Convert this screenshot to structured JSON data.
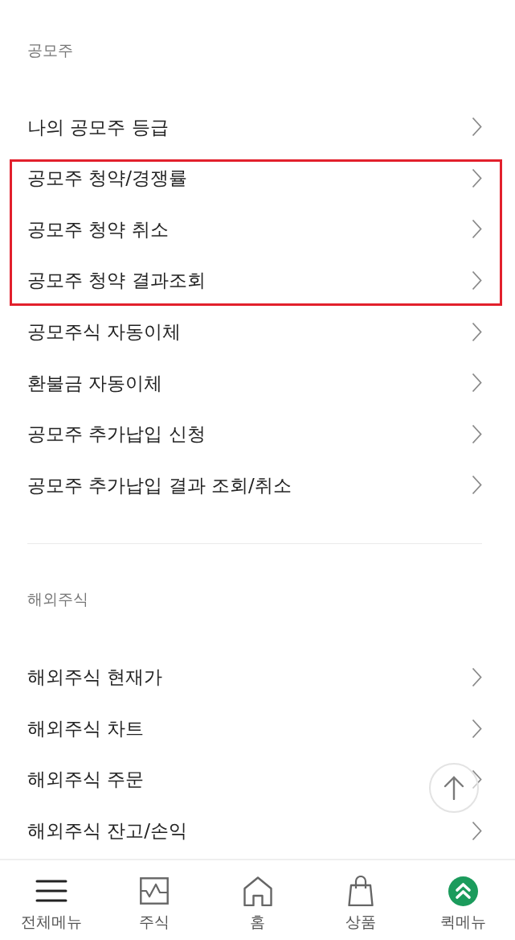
{
  "sections": [
    {
      "title": "공모주",
      "items": [
        {
          "label": "나의 공모주 등급",
          "highlighted": false
        },
        {
          "label": "공모주 청약/경쟁률",
          "highlighted": true
        },
        {
          "label": "공모주 청약 취소",
          "highlighted": true
        },
        {
          "label": "공모주 청약 결과조회",
          "highlighted": true
        },
        {
          "label": "공모주식 자동이체",
          "highlighted": false
        },
        {
          "label": "환불금 자동이체",
          "highlighted": false
        },
        {
          "label": "공모주 추가납입 신청",
          "highlighted": false
        },
        {
          "label": "공모주 추가납입 결과 조회/취소",
          "highlighted": false
        }
      ]
    },
    {
      "title": "해외주식",
      "items": [
        {
          "label": "해외주식 현재가",
          "highlighted": false
        },
        {
          "label": "해외주식 차트",
          "highlighted": false
        },
        {
          "label": "해외주식 주문",
          "highlighted": false
        },
        {
          "label": "해외주식 잔고/손익",
          "highlighted": false
        }
      ]
    }
  ],
  "bottom_nav": {
    "items": [
      {
        "label": "전체메뉴"
      },
      {
        "label": "주식"
      },
      {
        "label": "홈"
      },
      {
        "label": "상품"
      },
      {
        "label": "퀵메뉴"
      }
    ]
  }
}
